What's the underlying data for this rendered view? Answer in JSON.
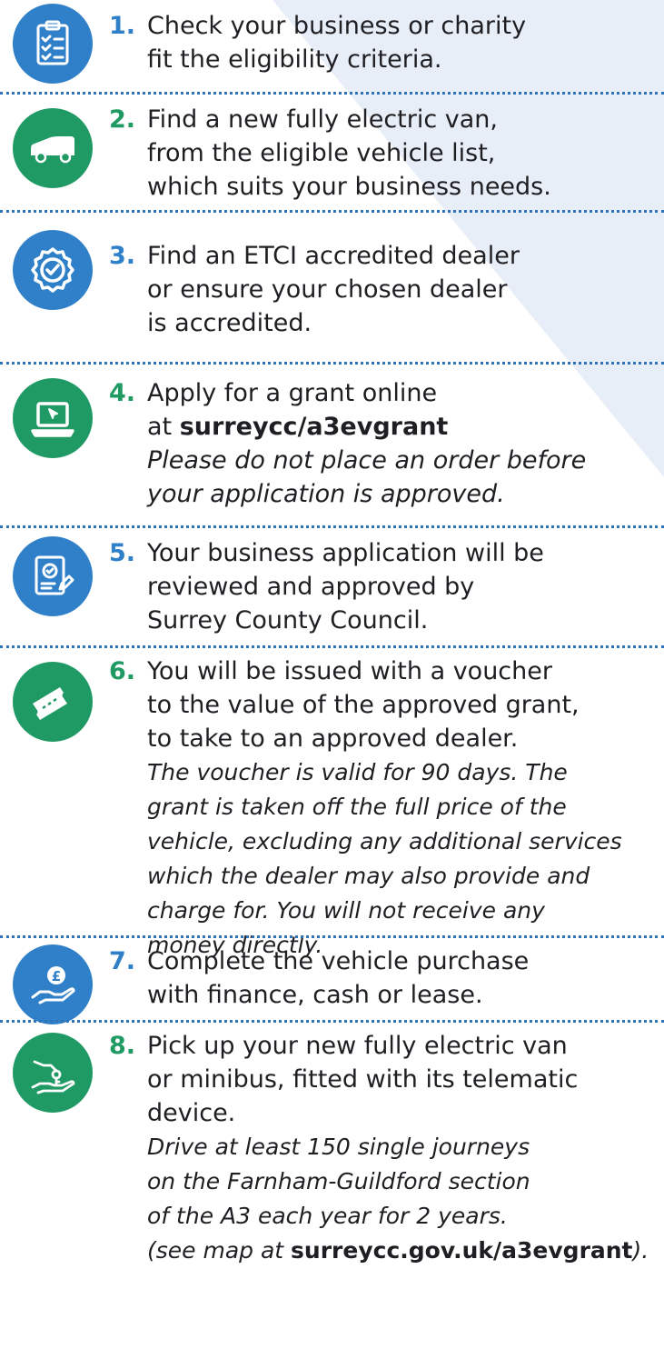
{
  "colors": {
    "blue": "#2f80c8",
    "green": "#1f9a64",
    "num_blue": "#2f80c8",
    "num_green": "#1e9a62",
    "divider": "#2e73b8",
    "bg_tint": "#e8eef7"
  },
  "steps": [
    {
      "number": "1.",
      "text": "Check your business or charity\nfit the eligibility criteria.",
      "icon": "checklist-icon",
      "color": "blue"
    },
    {
      "number": "2.",
      "text": "Find a new fully electric van,\nfrom the eligible vehicle list,\nwhich suits your business needs.",
      "icon": "van-icon",
      "color": "green"
    },
    {
      "number": "3.",
      "text": "Find an ETCI accredited dealer\nor ensure your chosen dealer\nis accredited.",
      "icon": "accredited-badge-icon",
      "color": "blue"
    },
    {
      "number": "4.",
      "text": "Apply for a grant online\nat ",
      "link": "surreycc/a3evgrant",
      "note": "Please do not place an order before\nyour application is approved.",
      "icon": "laptop-icon",
      "color": "green"
    },
    {
      "number": "5.",
      "text": "Your business application will be\nreviewed and approved by\nSurrey County Council.",
      "icon": "approved-document-icon",
      "color": "blue"
    },
    {
      "number": "6.",
      "text": "You will be issued with a voucher\nto the value of the approved grant,\nto take to an approved dealer.",
      "note": "The voucher is valid for 90 days. The\ngrant is taken off the full price of the\nvehicle, excluding any additional services\nwhich the dealer may also provide and\ncharge for. You will not receive any\nmoney directly.",
      "icon": "voucher-ticket-icon",
      "color": "green"
    },
    {
      "number": "7.",
      "text": "Complete the vehicle purchase\nwith finance, cash or lease.",
      "icon": "hand-pound-coin-icon",
      "color": "blue"
    },
    {
      "number": "8.",
      "text": "Pick up your new fully electric van\nor minibus, fitted with its telematic\ndevice.",
      "note": "Drive at least 150 single journeys\non the Farnham-Guildford section\nof the A3 each year for 2 years.\n(see map at ",
      "note_link": "surreycc.gov.uk/a3evgrant",
      "note_end": ").",
      "icon": "key-handover-icon",
      "color": "green"
    }
  ]
}
